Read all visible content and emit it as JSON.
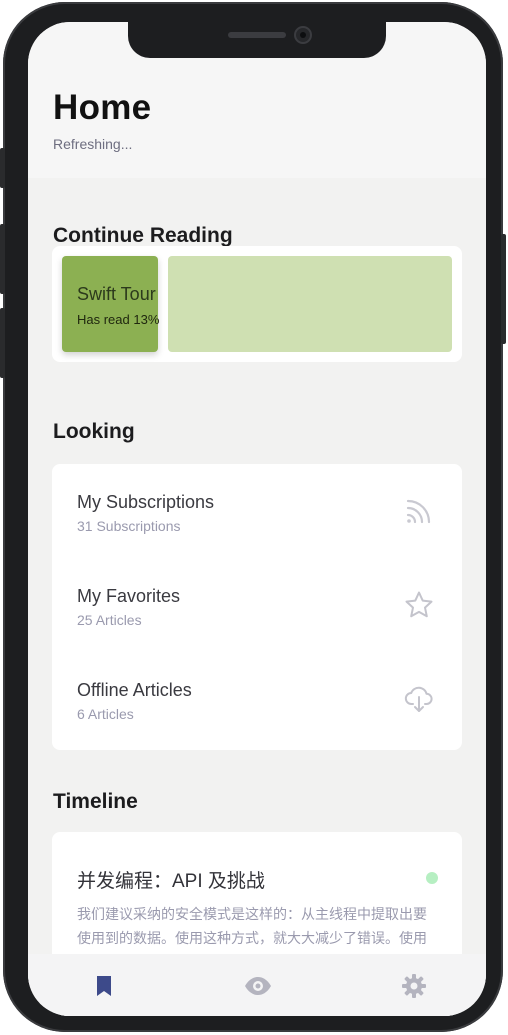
{
  "header": {
    "title": "Home",
    "status": "Refreshing..."
  },
  "continue_reading": {
    "section_title": "Continue Reading",
    "book": {
      "title": "Swift Tour",
      "progress_text": "Has read 13%",
      "progress_percent": 13,
      "cover_color": "#8cb052",
      "accent_color": "#cfe0b2"
    }
  },
  "looking": {
    "section_title": "Looking",
    "items": [
      {
        "title": "My Subscriptions",
        "subtitle": "31 Subscriptions",
        "icon": "rss-icon"
      },
      {
        "title": "My Favorites",
        "subtitle": "25 Articles",
        "icon": "star-icon"
      },
      {
        "title": "Offline Articles",
        "subtitle": "6 Articles",
        "icon": "cloud-download-icon"
      }
    ]
  },
  "timeline": {
    "section_title": "Timeline",
    "entries": [
      {
        "title": "并发编程：API 及挑战",
        "body": "我们建议采纳的安全模式是这样的：从主线程中提取出要使用到的数据。使用这种方式，就大大减少了错误。使用这种方式，就大大减少了错误。",
        "status_color": "#b6efc2"
      }
    ]
  },
  "tabbar": {
    "tabs": [
      {
        "icon": "bookmark-icon",
        "active": true
      },
      {
        "icon": "eye-icon",
        "active": false
      },
      {
        "icon": "gear-icon",
        "active": false
      }
    ],
    "active_color": "#3d4a8a",
    "inactive_color": "#b4b4bf"
  }
}
